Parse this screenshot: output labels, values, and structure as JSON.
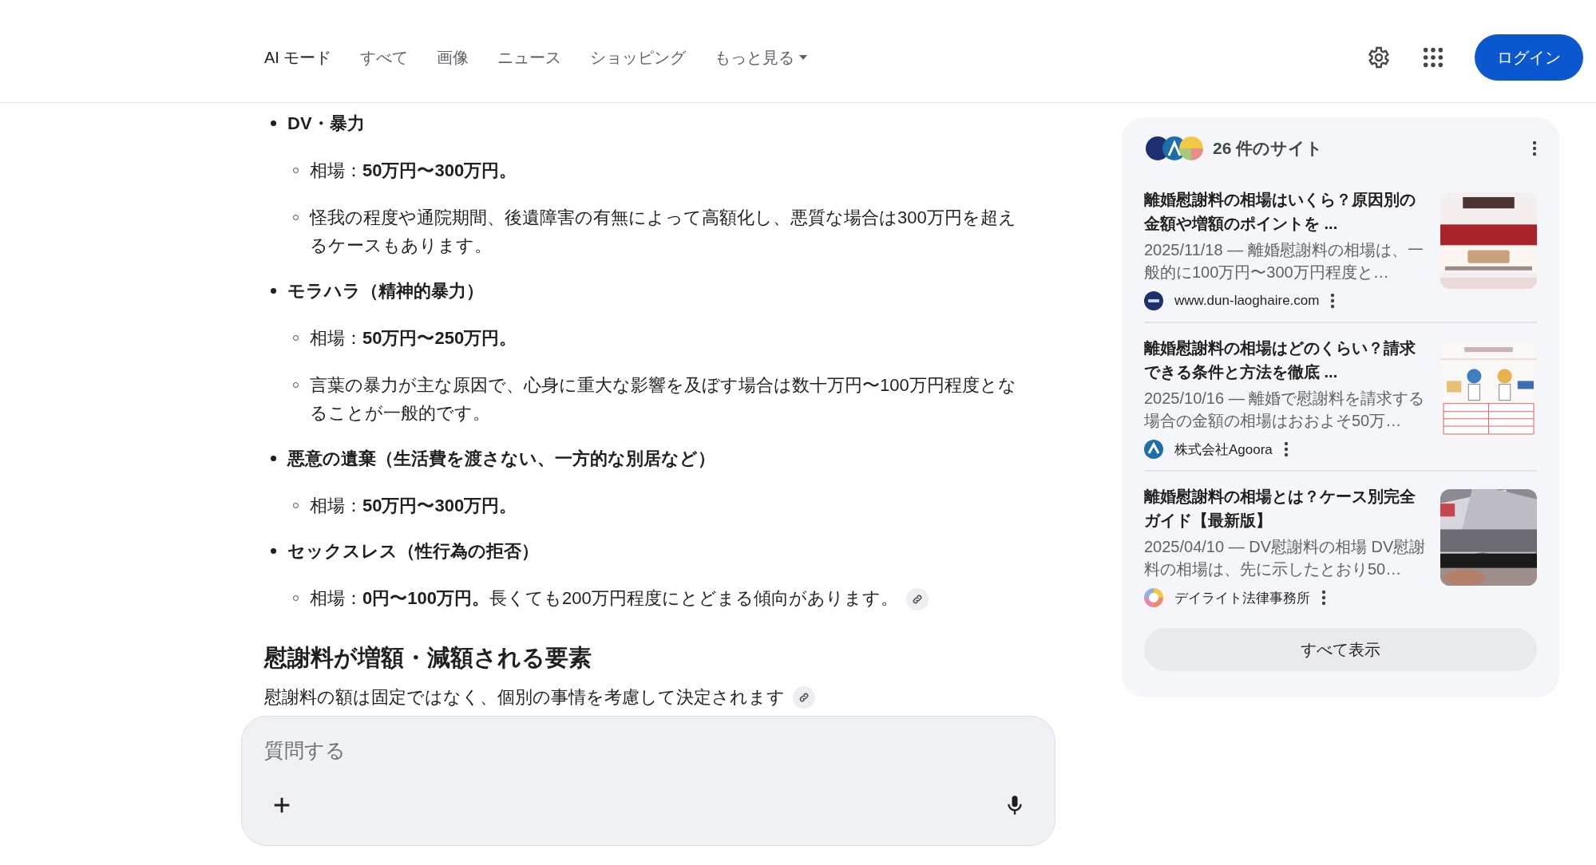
{
  "header": {
    "tabs": [
      {
        "label": "AI モード",
        "selected": true
      },
      {
        "label": "すべて",
        "selected": false
      },
      {
        "label": "画像",
        "selected": false
      },
      {
        "label": "ニュース",
        "selected": false
      },
      {
        "label": "ショッピング",
        "selected": false
      },
      {
        "label": "もっと見る",
        "selected": false,
        "dropdown": true
      }
    ],
    "login_button": "ログイン"
  },
  "answer": {
    "items": [
      {
        "title": "DV・暴力",
        "children": [
          {
            "text": "相場：**50万円〜300万円。**",
            "has_link": false
          },
          {
            "text": "怪我の程度や通院期間、後遺障害の有無によって高額化し、悪質な場合は300万円を超えるケースもあります。",
            "has_link": false
          }
        ]
      },
      {
        "title": "モラハラ（精神的暴力）",
        "children": [
          {
            "text": "相場：**50万円〜250万円。**",
            "has_link": false
          },
          {
            "text": "言葉の暴力が主な原因で、心身に重大な影響を及ぼす場合は数十万円〜100万円程度となることが一般的です。",
            "has_link": false
          }
        ]
      },
      {
        "title": "悪意の遺棄（生活費を渡さない、一方的な別居など）",
        "children": [
          {
            "text": "相場：**50万円〜300万円。**",
            "has_link": false
          }
        ]
      },
      {
        "title": "セックスレス（性行為の拒否）",
        "children": [
          {
            "text": "相場：**0円〜100万円。**長くても200万円程度にとどまる傾向があります。",
            "has_link": true
          }
        ]
      }
    ],
    "heading": "慰謝料が増額・減額される要素",
    "paragraph": {
      "text": "慰謝料の額は固定ではなく、個別の事情を考慮して決定されます",
      "has_link": true
    }
  },
  "sources": {
    "count_label": "26 件のサイト",
    "results": [
      {
        "title": "離婚慰謝料の相場はいくら？原因別の金額や増額のポイントを ...",
        "snippet": "2025/11/18 — 離婚慰謝料の相場は、一般的に100万円〜300万円程度と…",
        "source": "www.dun-laoghaire.com"
      },
      {
        "title": "離婚慰謝料の相場はどのくらい？請求できる条件と方法を徹底 ...",
        "snippet": "2025/10/16 — 離婚で慰謝料を請求する場合の金額の相場はおおよそ50万…",
        "source": "株式会社Agoora"
      },
      {
        "title": "離婚慰謝料の相場とは？ケース別完全ガイド【最新版】",
        "snippet": "2025/04/10 — DV慰謝料の相場 DV慰謝料の相場は、先に示したとおり50…",
        "source": "デイライト法律事務所"
      }
    ],
    "show_all_button": "すべて表示"
  },
  "ask_box": {
    "placeholder": "質問する"
  }
}
